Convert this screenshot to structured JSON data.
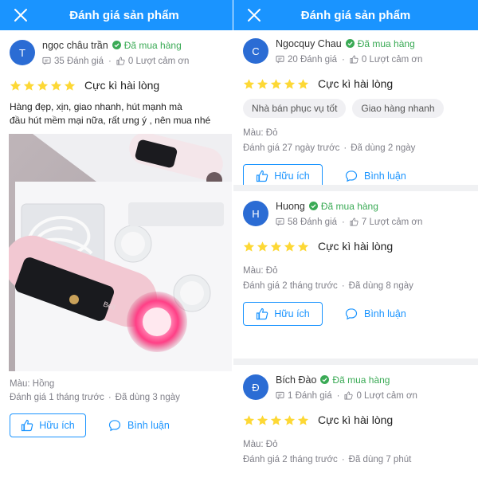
{
  "left": {
    "header_title": "Đánh giá sản phẩm",
    "review": {
      "avatar_letter": "T",
      "name": "ngọc châu trần",
      "verified_label": "Đã mua hàng",
      "review_count": "35 Đánh giá",
      "thanks_count": "0 Lượt cảm ơn",
      "rating_text": "Cực kì hài lòng",
      "content": "Hàng đẹp, xịn, giao nhanh, hút mạnh mà\n đầu hút mềm mại nữa, rất ưng ý , nên mua nhé",
      "color": "Màu: Hồng",
      "reviewed_ago": "Đánh giá 1 tháng trước",
      "used_for": "Đã dùng 3 ngày",
      "helpful_label": "Hữu ích",
      "comment_label": "Bình luận"
    }
  },
  "right": {
    "header_title": "Đánh giá sản phẩm",
    "reviews": [
      {
        "avatar_letter": "C",
        "name": "Ngocquy Chau",
        "verified_label": "Đã mua hàng",
        "review_count": "20 Đánh giá",
        "thanks_count": "0 Lượt cảm ơn",
        "rating_text": "Cực kì hài lòng",
        "chips": [
          "Nhà bán phục vụ tốt",
          "Giao hàng nhanh"
        ],
        "color": "Màu: Đỏ",
        "reviewed_ago": "Đánh giá 27 ngày trước",
        "used_for": "Đã dùng 2 ngày",
        "helpful_label": "Hữu ích",
        "comment_label": "Bình luận"
      },
      {
        "avatar_letter": "H",
        "name": "Huong",
        "verified_label": "Đã mua hàng",
        "review_count": "58 Đánh giá",
        "thanks_count": "7 Lượt cảm ơn",
        "rating_text": "Cực kì hài lòng",
        "color": "Màu: Đỏ",
        "reviewed_ago": "Đánh giá 2 tháng trước",
        "used_for": "Đã dùng 8 ngày",
        "helpful_label": "Hữu ích",
        "comment_label": "Bình luận"
      },
      {
        "avatar_letter": "Đ",
        "name": "Bích Đào",
        "verified_label": "Đã mua hàng",
        "review_count": "1 Đánh giá",
        "thanks_count": "0 Lượt cảm ơn",
        "rating_text": "Cực kì hài lòng",
        "color": "Màu: Đỏ",
        "reviewed_ago": "Đánh giá 2 tháng trước",
        "used_for": "Đã dùng 7 phút"
      }
    ]
  },
  "rating_stars": 5,
  "colors": {
    "accent": "#1a94ff",
    "verified": "#3aaa55",
    "star": "#fdd835",
    "avatar": "#2b6cd4",
    "muted": "#808089"
  },
  "icons": [
    "close-icon",
    "verified-check-icon",
    "review-count-icon",
    "thumbs-up-icon",
    "star-icon",
    "comment-icon"
  ]
}
